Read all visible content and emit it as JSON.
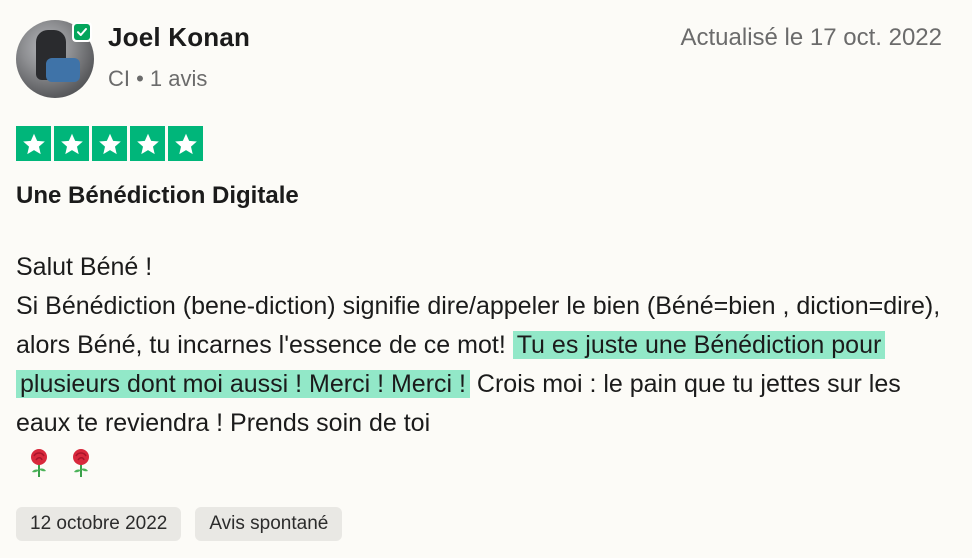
{
  "reviewer": {
    "name": "Joel Konan",
    "meta": "CI • 1 avis",
    "verified_icon": "verified-check-icon"
  },
  "updated_label": "Actualisé le 17 oct. 2022",
  "rating": {
    "stars": 5,
    "max": 5,
    "color": "#00b67a"
  },
  "review": {
    "title": "Une Bénédiction Digitale",
    "line1": "Salut Béné !",
    "line2_part1": "Si Bénédiction (bene-diction) signifie dire/appeler le bien (Béné=bien , diction=dire), alors Béné, tu incarnes l'essence de ce mot! ",
    "highlight": "Tu es juste une Bénédiction pour plusieurs dont moi aussi ! Merci ! Merci !",
    "line2_part2": " Crois moi : le pain que tu jettes sur les eaux te reviendra ! Prends soin de toi",
    "emoji": "rose-icon",
    "highlight_color": "#92e8c8"
  },
  "tags": [
    "12 octobre 2022",
    "Avis spontané"
  ]
}
